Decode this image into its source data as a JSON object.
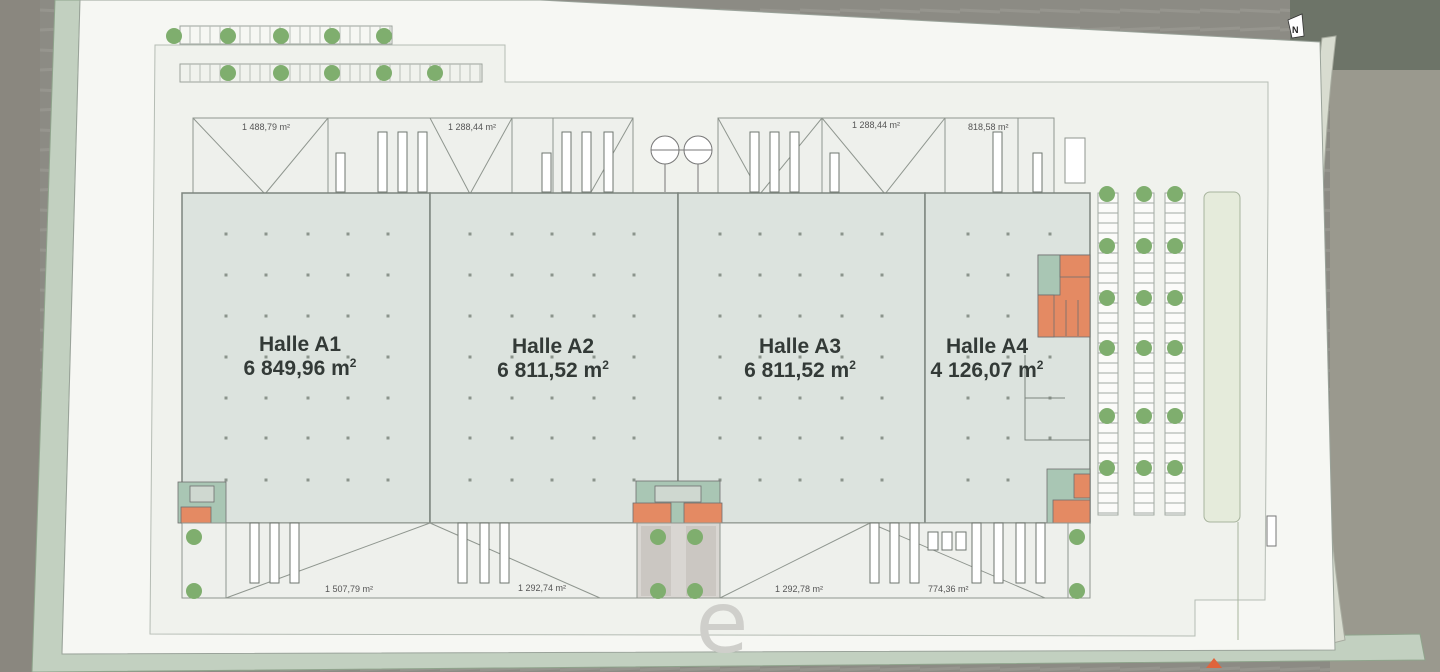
{
  "halls": [
    {
      "id": "a1",
      "name": "Halle A1",
      "area": "6 849,96 m",
      "unit_sup": "2"
    },
    {
      "id": "a2",
      "name": "Halle A2",
      "area": "6 811,52 m",
      "unit_sup": "2"
    },
    {
      "id": "a3",
      "name": "Halle A3",
      "area": "6 811,52 m",
      "unit_sup": "2"
    },
    {
      "id": "a4",
      "name": "Halle A4",
      "area": "4 126,07 m",
      "unit_sup": "2"
    }
  ],
  "north_areas": [
    "1 488,79 m²",
    "1 288,44 m²",
    "1 288,44 m²",
    "818,58 m²"
  ],
  "south_areas": [
    "1 507,79 m²",
    "1 292,74 m²",
    "1 292,78 m²",
    "774,36 m²"
  ],
  "north_arrow": "N",
  "watermark": "e",
  "colors": {
    "hall_fill": "#dce3de",
    "site_fill": "#f1f3ee",
    "road": "#c2d0c0",
    "tree": "#7fae6e",
    "office_orange": "#e48a63",
    "office_green": "#a9c6b4",
    "aerial_dark": "#858580"
  }
}
